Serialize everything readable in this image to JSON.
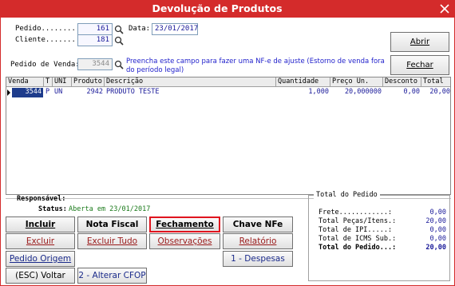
{
  "window": {
    "title": "Devolução de Produtos"
  },
  "form": {
    "pedido": {
      "label": "Pedido........:",
      "value": "161"
    },
    "data": {
      "label": "Data:",
      "value": "23/01/2017"
    },
    "cliente": {
      "label": "Cliente.......:",
      "value": "181"
    },
    "pedido_venda": {
      "label": "Pedido de Venda:",
      "value": "3544"
    },
    "hint": "Preencha este campo para fazer uma NF-e de ajuste (Estorno de venda fora do período legal)"
  },
  "side_buttons": {
    "abrir": "Abrir",
    "fechar": "Fechar"
  },
  "grid": {
    "columns": [
      "Venda",
      "T",
      "UNI",
      "Produto",
      "Descrição",
      "Quantidade",
      "Preço Un.",
      "Desconto",
      "Total"
    ],
    "rows": [
      {
        "venda": "3544",
        "t": "P",
        "uni": "UN",
        "produto": "2942",
        "descricao": "PRODUTO TESTE",
        "quantidade": "1,000",
        "preco": "20,000000",
        "desconto": "0,00",
        "total": "20,00"
      }
    ]
  },
  "info": {
    "responsavel_label": "Responsável:",
    "status_label": "Status:",
    "status_value": "Aberta em 23/01/2017"
  },
  "buttons": {
    "incluir": "Incluir",
    "nota_fiscal": "Nota Fiscal",
    "fechamento": "Fechamento",
    "chave_nfe": "Chave NFe",
    "excluir": "Excluir",
    "excluir_tudo": "Excluir Tudo",
    "observacoes": "Observações",
    "relatorio": "Relatório",
    "pedido_origem": "Pedido Origem",
    "despesas": "1 - Despesas",
    "voltar": "(ESC) Voltar",
    "alterar_cfop": "2 - Alterar CFOP"
  },
  "totals": {
    "legend": "Total do Pedido",
    "rows": [
      {
        "label": "Frete............:",
        "value": "0,00"
      },
      {
        "label": "Total Peças/Itens.:",
        "value": "20,00"
      },
      {
        "label": "Total de IPI.....:",
        "value": "0,00"
      },
      {
        "label": "Total de ICMS Sub.:",
        "value": "0,00"
      },
      {
        "label": "Total do Pedido...:",
        "value": "20,00"
      }
    ]
  },
  "colors": {
    "title_bar": "#d42b2b",
    "highlight": "#e0141e",
    "selection": "#1e3c8c"
  }
}
